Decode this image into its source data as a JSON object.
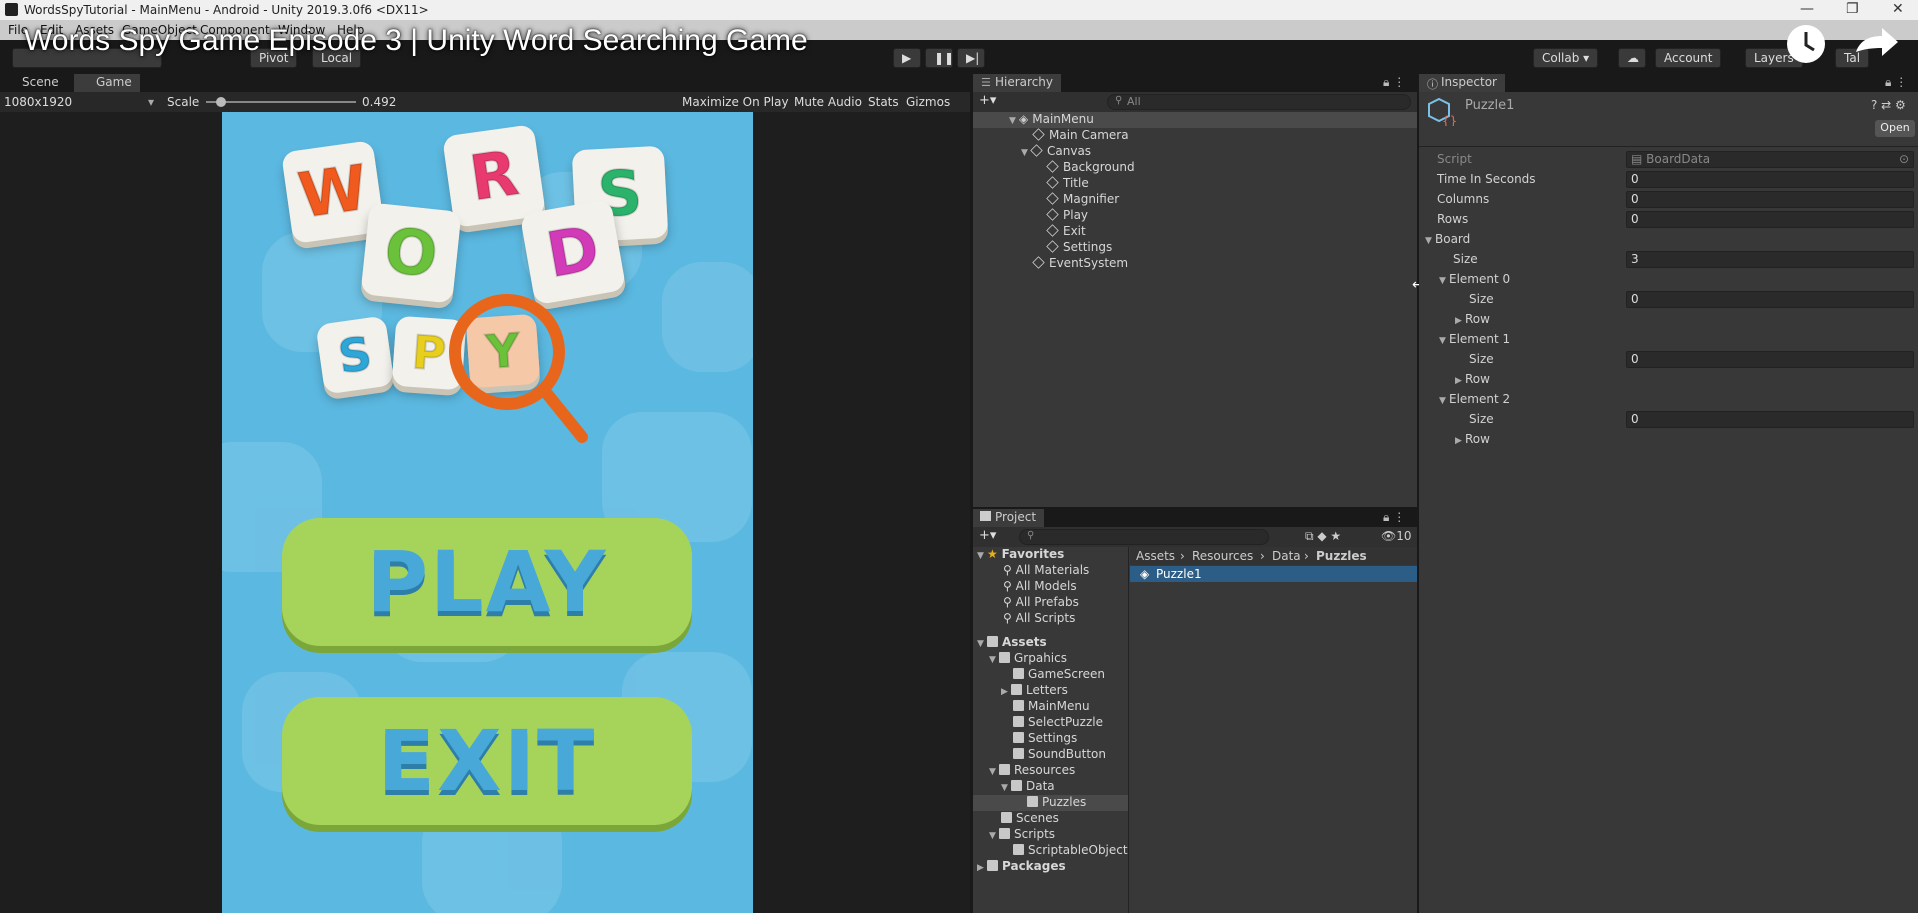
{
  "window": {
    "title": "WordsSpyTutorial - MainMenu - Android - Unity 2019.3.0f6 <DX11>",
    "controls": [
      "—",
      "❐",
      "✕"
    ]
  },
  "menubar": [
    "File",
    "Edit",
    "Assets",
    "GameObject",
    "Component",
    "Window",
    "Help"
  ],
  "video_overlay": {
    "title": "Words Spy Game Episode 3 | Unity Word Searching Game"
  },
  "toolbar": {
    "pivot": "Pivot",
    "local": "Local",
    "collab": "Collab ▾",
    "account": "Account",
    "layers": "Layers",
    "layout": "Tal"
  },
  "scene_panel": {
    "tabs": [
      "Scene",
      "Game"
    ],
    "resolution": "1080x1920",
    "scale_label": "Scale",
    "scale_value": "0.492",
    "scale_fraction": 0.1,
    "options": [
      "Maximize On Play",
      "Mute Audio",
      "Stats",
      "Gizmos"
    ]
  },
  "game": {
    "letters_words": [
      "W",
      "R",
      "S",
      "O",
      "D"
    ],
    "letters_spy": [
      "S",
      "P",
      "Y"
    ],
    "play_label": "PLAY",
    "exit_label": "EXIT",
    "colors": {
      "bg": "#5bb8e0",
      "button": "#a6d45a",
      "w": "#f05a1e",
      "r": "#e83a6e",
      "s": "#2bb36b",
      "o": "#6ac23a",
      "d": "#d33ab8",
      "blue": "#2fa6d8",
      "yellow": "#e8cf1e",
      "magnifier": "#e8661c"
    }
  },
  "hierarchy": {
    "tab": "Hierarchy",
    "search_placeholder": "All",
    "items": [
      {
        "label": "MainMenu"
      },
      {
        "label": "Main Camera"
      },
      {
        "label": "Canvas"
      },
      {
        "label": "Background"
      },
      {
        "label": "Title"
      },
      {
        "label": "Magnifier"
      },
      {
        "label": "Play"
      },
      {
        "label": "Exit"
      },
      {
        "label": "Settings"
      },
      {
        "label": "EventSystem"
      }
    ]
  },
  "project": {
    "tab": "Project",
    "hidden_count": "10",
    "favorites": {
      "label": "Favorites",
      "items": [
        "All Materials",
        "All Models",
        "All Prefabs",
        "All Scripts"
      ]
    },
    "tree": [
      {
        "label": "Assets"
      },
      {
        "label": "Grpahics"
      },
      {
        "label": "GameScreen"
      },
      {
        "label": "Letters"
      },
      {
        "label": "MainMenu"
      },
      {
        "label": "SelectPuzzle"
      },
      {
        "label": "Settings"
      },
      {
        "label": "SoundButton"
      },
      {
        "label": "Resources"
      },
      {
        "label": "Data"
      },
      {
        "label": "Puzzles"
      },
      {
        "label": "Scenes"
      },
      {
        "label": "Scripts"
      },
      {
        "label": "ScriptableObject"
      },
      {
        "label": "Packages"
      }
    ],
    "breadcrumb": [
      "Assets",
      "Resources",
      "Data",
      "Puzzles"
    ],
    "files": [
      "Puzzle1"
    ]
  },
  "inspector": {
    "tab": "Inspector",
    "object_name": "Puzzle1",
    "open_label": "Open",
    "script_label": "Script",
    "script_value": "BoardData",
    "fields": [
      {
        "label": "Time In Seconds",
        "value": "0"
      },
      {
        "label": "Columns",
        "value": "0"
      },
      {
        "label": "Rows",
        "value": "0"
      }
    ],
    "board": {
      "label": "Board",
      "size_label": "Size",
      "size_value": "3",
      "elements": [
        {
          "label": "Element 0",
          "size_label": "Size",
          "size_value": "0",
          "row_label": "Row"
        },
        {
          "label": "Element 1",
          "size_label": "Size",
          "size_value": "0",
          "row_label": "Row"
        },
        {
          "label": "Element 2",
          "size_label": "Size",
          "size_value": "0",
          "row_label": "Row"
        }
      ]
    }
  }
}
